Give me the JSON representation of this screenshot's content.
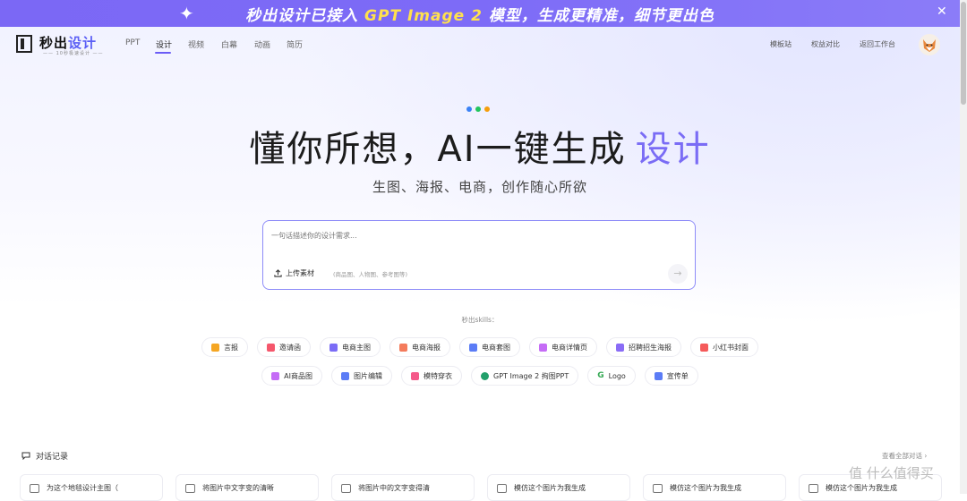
{
  "banner": {
    "text_before": "秒出设计已接入 ",
    "highlight": "GPT Image 2",
    "text_after": " 模型，生成更精准，细节更出色",
    "close": "✕"
  },
  "logo": {
    "name_a": "秒出",
    "name_b": "设计",
    "sub": "—— 10秒极速设计 ——"
  },
  "nav": {
    "items": [
      "PPT",
      "设计",
      "视频",
      "白幕",
      "动画",
      "简历"
    ],
    "active": "设计",
    "right": [
      "模板站",
      "权益对比",
      "返回工作台"
    ]
  },
  "hero": {
    "title_main": "懂你所想，AI一键生成",
    "title_accent": "设计",
    "subtitle": "生图、海报、电商，创作随心所欲",
    "dot_colors": [
      "#3b82f6",
      "#22c55e",
      "#f59e0b"
    ]
  },
  "input": {
    "placeholder": "一句话描述你的设计需求...",
    "upload_label": "上传素材",
    "upload_hint": "(商品图、人物图、参考图等)",
    "send_icon": "→"
  },
  "skills": {
    "label": "秒出skills：",
    "row1": [
      {
        "label": "言报",
        "icon": "poster-icon",
        "color": "#f5a623"
      },
      {
        "label": "邀请函",
        "icon": "invite-icon",
        "color": "#f5576c"
      },
      {
        "label": "电商主图",
        "icon": "image-icon",
        "color": "#7b6cf6"
      },
      {
        "label": "电商海报",
        "icon": "poster-icon",
        "color": "#f47b5c"
      },
      {
        "label": "电商套图",
        "icon": "gallery-icon",
        "color": "#5b7cf6"
      },
      {
        "label": "电商详情页",
        "icon": "detail-icon",
        "color": "#c56cf6"
      },
      {
        "label": "招聘招生海报",
        "icon": "recruit-icon",
        "color": "#8a6cf6"
      },
      {
        "label": "小红书封面",
        "icon": "book-icon",
        "color": "#f55a5a"
      }
    ],
    "row2": [
      {
        "label": "AI商品图",
        "icon": "product-icon",
        "color": "#c56cf6"
      },
      {
        "label": "图片编辑",
        "icon": "edit-icon",
        "color": "#5b7cf6"
      },
      {
        "label": "模特穿衣",
        "icon": "model-icon",
        "color": "#f55a8a"
      },
      {
        "label": "GPT Image 2 拘图PPT",
        "icon": "openai-icon",
        "color": "#22a06b"
      },
      {
        "label": "Logo",
        "icon": "google-icon",
        "color": "#34a853"
      },
      {
        "label": "宣传单",
        "icon": "flyer-icon",
        "color": "#5b7cf6"
      }
    ]
  },
  "history": {
    "title": "对话记录",
    "view_all": "查看全部对话 ›",
    "items": [
      "为这个地毯设计主图（",
      "将图片中文字变的清晰",
      "将图片中的文字变得清",
      "模仿这个图片为我生成",
      "模仿这个图片为我生成",
      "模仿这个图片为我生成"
    ]
  },
  "watermark": "值 什么值得买"
}
